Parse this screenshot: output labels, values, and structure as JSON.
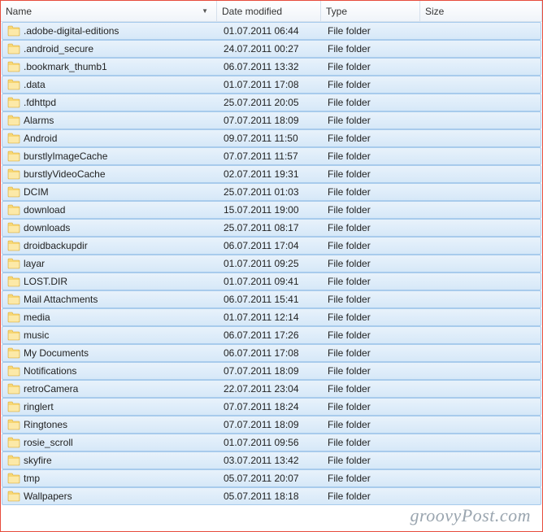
{
  "columns": {
    "name": "Name",
    "date": "Date modified",
    "type": "Type",
    "size": "Size"
  },
  "sort_indicator": "▼",
  "watermark": "groovyPost.com",
  "files": [
    {
      "name": ".adobe-digital-editions",
      "date": "01.07.2011 06:44",
      "type": "File folder",
      "size": ""
    },
    {
      "name": ".android_secure",
      "date": "24.07.2011 00:27",
      "type": "File folder",
      "size": ""
    },
    {
      "name": ".bookmark_thumb1",
      "date": "06.07.2011 13:32",
      "type": "File folder",
      "size": ""
    },
    {
      "name": ".data",
      "date": "01.07.2011 17:08",
      "type": "File folder",
      "size": ""
    },
    {
      "name": ".fdhttpd",
      "date": "25.07.2011 20:05",
      "type": "File folder",
      "size": ""
    },
    {
      "name": "Alarms",
      "date": "07.07.2011 18:09",
      "type": "File folder",
      "size": ""
    },
    {
      "name": "Android",
      "date": "09.07.2011 11:50",
      "type": "File folder",
      "size": ""
    },
    {
      "name": "burstlyImageCache",
      "date": "07.07.2011 11:57",
      "type": "File folder",
      "size": ""
    },
    {
      "name": "burstlyVideoCache",
      "date": "02.07.2011 19:31",
      "type": "File folder",
      "size": ""
    },
    {
      "name": "DCIM",
      "date": "25.07.2011 01:03",
      "type": "File folder",
      "size": ""
    },
    {
      "name": "download",
      "date": "15.07.2011 19:00",
      "type": "File folder",
      "size": ""
    },
    {
      "name": "downloads",
      "date": "25.07.2011 08:17",
      "type": "File folder",
      "size": ""
    },
    {
      "name": "droidbackupdir",
      "date": "06.07.2011 17:04",
      "type": "File folder",
      "size": ""
    },
    {
      "name": "layar",
      "date": "01.07.2011 09:25",
      "type": "File folder",
      "size": ""
    },
    {
      "name": "LOST.DIR",
      "date": "01.07.2011 09:41",
      "type": "File folder",
      "size": ""
    },
    {
      "name": "Mail Attachments",
      "date": "06.07.2011 15:41",
      "type": "File folder",
      "size": ""
    },
    {
      "name": "media",
      "date": "01.07.2011 12:14",
      "type": "File folder",
      "size": ""
    },
    {
      "name": "music",
      "date": "06.07.2011 17:26",
      "type": "File folder",
      "size": ""
    },
    {
      "name": "My Documents",
      "date": "06.07.2011 17:08",
      "type": "File folder",
      "size": ""
    },
    {
      "name": "Notifications",
      "date": "07.07.2011 18:09",
      "type": "File folder",
      "size": ""
    },
    {
      "name": "retroCamera",
      "date": "22.07.2011 23:04",
      "type": "File folder",
      "size": ""
    },
    {
      "name": "ringlert",
      "date": "07.07.2011 18:24",
      "type": "File folder",
      "size": ""
    },
    {
      "name": "Ringtones",
      "date": "07.07.2011 18:09",
      "type": "File folder",
      "size": ""
    },
    {
      "name": "rosie_scroll",
      "date": "01.07.2011 09:56",
      "type": "File folder",
      "size": ""
    },
    {
      "name": "skyfire",
      "date": "03.07.2011 13:42",
      "type": "File folder",
      "size": ""
    },
    {
      "name": "tmp",
      "date": "05.07.2011 20:07",
      "type": "File folder",
      "size": ""
    },
    {
      "name": "Wallpapers",
      "date": "05.07.2011 18:18",
      "type": "File folder",
      "size": ""
    }
  ]
}
